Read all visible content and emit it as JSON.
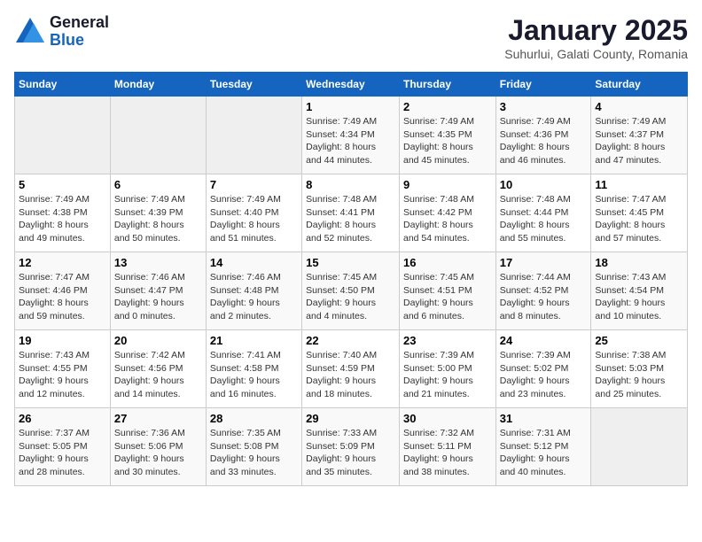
{
  "logo": {
    "general": "General",
    "blue": "Blue"
  },
  "title": "January 2025",
  "subtitle": "Suhurlui, Galati County, Romania",
  "days_of_week": [
    "Sunday",
    "Monday",
    "Tuesday",
    "Wednesday",
    "Thursday",
    "Friday",
    "Saturday"
  ],
  "weeks": [
    [
      {
        "day": "",
        "info": ""
      },
      {
        "day": "",
        "info": ""
      },
      {
        "day": "",
        "info": ""
      },
      {
        "day": "1",
        "info": "Sunrise: 7:49 AM\nSunset: 4:34 PM\nDaylight: 8 hours\nand 44 minutes."
      },
      {
        "day": "2",
        "info": "Sunrise: 7:49 AM\nSunset: 4:35 PM\nDaylight: 8 hours\nand 45 minutes."
      },
      {
        "day": "3",
        "info": "Sunrise: 7:49 AM\nSunset: 4:36 PM\nDaylight: 8 hours\nand 46 minutes."
      },
      {
        "day": "4",
        "info": "Sunrise: 7:49 AM\nSunset: 4:37 PM\nDaylight: 8 hours\nand 47 minutes."
      }
    ],
    [
      {
        "day": "5",
        "info": "Sunrise: 7:49 AM\nSunset: 4:38 PM\nDaylight: 8 hours\nand 49 minutes."
      },
      {
        "day": "6",
        "info": "Sunrise: 7:49 AM\nSunset: 4:39 PM\nDaylight: 8 hours\nand 50 minutes."
      },
      {
        "day": "7",
        "info": "Sunrise: 7:49 AM\nSunset: 4:40 PM\nDaylight: 8 hours\nand 51 minutes."
      },
      {
        "day": "8",
        "info": "Sunrise: 7:48 AM\nSunset: 4:41 PM\nDaylight: 8 hours\nand 52 minutes."
      },
      {
        "day": "9",
        "info": "Sunrise: 7:48 AM\nSunset: 4:42 PM\nDaylight: 8 hours\nand 54 minutes."
      },
      {
        "day": "10",
        "info": "Sunrise: 7:48 AM\nSunset: 4:44 PM\nDaylight: 8 hours\nand 55 minutes."
      },
      {
        "day": "11",
        "info": "Sunrise: 7:47 AM\nSunset: 4:45 PM\nDaylight: 8 hours\nand 57 minutes."
      }
    ],
    [
      {
        "day": "12",
        "info": "Sunrise: 7:47 AM\nSunset: 4:46 PM\nDaylight: 8 hours\nand 59 minutes."
      },
      {
        "day": "13",
        "info": "Sunrise: 7:46 AM\nSunset: 4:47 PM\nDaylight: 9 hours\nand 0 minutes."
      },
      {
        "day": "14",
        "info": "Sunrise: 7:46 AM\nSunset: 4:48 PM\nDaylight: 9 hours\nand 2 minutes."
      },
      {
        "day": "15",
        "info": "Sunrise: 7:45 AM\nSunset: 4:50 PM\nDaylight: 9 hours\nand 4 minutes."
      },
      {
        "day": "16",
        "info": "Sunrise: 7:45 AM\nSunset: 4:51 PM\nDaylight: 9 hours\nand 6 minutes."
      },
      {
        "day": "17",
        "info": "Sunrise: 7:44 AM\nSunset: 4:52 PM\nDaylight: 9 hours\nand 8 minutes."
      },
      {
        "day": "18",
        "info": "Sunrise: 7:43 AM\nSunset: 4:54 PM\nDaylight: 9 hours\nand 10 minutes."
      }
    ],
    [
      {
        "day": "19",
        "info": "Sunrise: 7:43 AM\nSunset: 4:55 PM\nDaylight: 9 hours\nand 12 minutes."
      },
      {
        "day": "20",
        "info": "Sunrise: 7:42 AM\nSunset: 4:56 PM\nDaylight: 9 hours\nand 14 minutes."
      },
      {
        "day": "21",
        "info": "Sunrise: 7:41 AM\nSunset: 4:58 PM\nDaylight: 9 hours\nand 16 minutes."
      },
      {
        "day": "22",
        "info": "Sunrise: 7:40 AM\nSunset: 4:59 PM\nDaylight: 9 hours\nand 18 minutes."
      },
      {
        "day": "23",
        "info": "Sunrise: 7:39 AM\nSunset: 5:00 PM\nDaylight: 9 hours\nand 21 minutes."
      },
      {
        "day": "24",
        "info": "Sunrise: 7:39 AM\nSunset: 5:02 PM\nDaylight: 9 hours\nand 23 minutes."
      },
      {
        "day": "25",
        "info": "Sunrise: 7:38 AM\nSunset: 5:03 PM\nDaylight: 9 hours\nand 25 minutes."
      }
    ],
    [
      {
        "day": "26",
        "info": "Sunrise: 7:37 AM\nSunset: 5:05 PM\nDaylight: 9 hours\nand 28 minutes."
      },
      {
        "day": "27",
        "info": "Sunrise: 7:36 AM\nSunset: 5:06 PM\nDaylight: 9 hours\nand 30 minutes."
      },
      {
        "day": "28",
        "info": "Sunrise: 7:35 AM\nSunset: 5:08 PM\nDaylight: 9 hours\nand 33 minutes."
      },
      {
        "day": "29",
        "info": "Sunrise: 7:33 AM\nSunset: 5:09 PM\nDaylight: 9 hours\nand 35 minutes."
      },
      {
        "day": "30",
        "info": "Sunrise: 7:32 AM\nSunset: 5:11 PM\nDaylight: 9 hours\nand 38 minutes."
      },
      {
        "day": "31",
        "info": "Sunrise: 7:31 AM\nSunset: 5:12 PM\nDaylight: 9 hours\nand 40 minutes."
      },
      {
        "day": "",
        "info": ""
      }
    ]
  ]
}
